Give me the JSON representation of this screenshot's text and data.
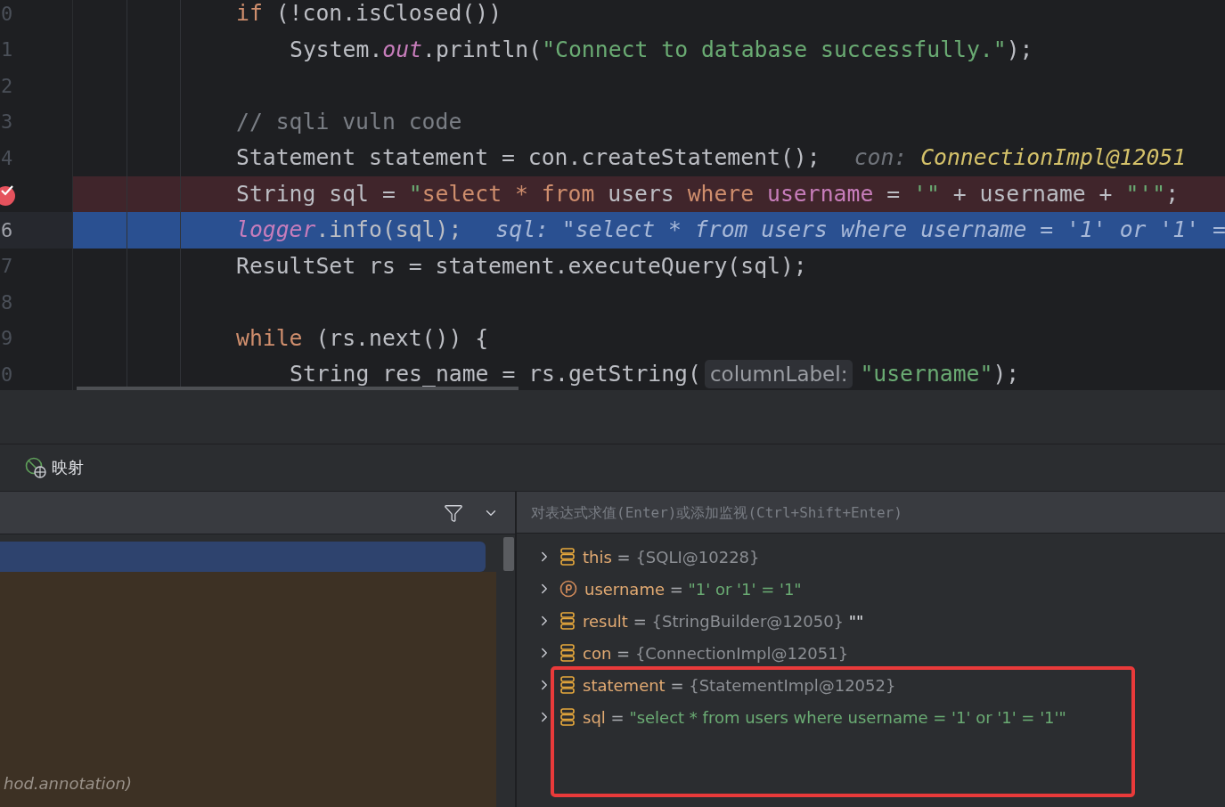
{
  "editor": {
    "lines": [
      {
        "number": "0",
        "kind": "outer",
        "current": false,
        "breakpoint": false,
        "segments": [
          {
            "kind": "code",
            "tokens": [
              {
                "text": "if",
                "kind": "keyword"
              },
              {
                "text": " (!con.isClosed())",
                "kind": "plain"
              }
            ]
          }
        ]
      },
      {
        "number": "1",
        "kind": "inner",
        "current": false,
        "breakpoint": false,
        "segments": [
          {
            "kind": "code",
            "tokens": [
              {
                "text": "System.",
                "kind": "plain"
              },
              {
                "text": "out",
                "kind": "static"
              },
              {
                "text": ".println(",
                "kind": "plain"
              },
              {
                "text": "\"Connect to database successfully.\"",
                "kind": "string"
              },
              {
                "text": ");",
                "kind": "plain"
              }
            ]
          }
        ]
      },
      {
        "number": "2",
        "kind": "outer",
        "current": false,
        "breakpoint": false
      },
      {
        "number": "3",
        "kind": "outer",
        "current": false,
        "breakpoint": false,
        "segments": [
          {
            "kind": "code",
            "tokens": [
              {
                "text": "// sqli vuln code",
                "kind": "comment"
              }
            ]
          }
        ]
      },
      {
        "number": "4",
        "kind": "outer",
        "current": false,
        "breakpoint": false,
        "segments": [
          {
            "kind": "code",
            "tokens": [
              {
                "text": "Statement statement = con.createStatement();",
                "kind": "plain"
              }
            ]
          },
          {
            "kind": "hint",
            "label": "con: ",
            "text": "ConnectionImpl@12051"
          }
        ]
      },
      {
        "kind": "outer",
        "current": false,
        "breakpoint": true,
        "segments": [
          {
            "kind": "code",
            "tokens": [
              {
                "text": "String sql = ",
                "kind": "plain"
              },
              {
                "text": "\"",
                "kind": "string"
              },
              {
                "text": "select * from",
                "kind": "sql_keyword"
              },
              {
                "text": " users ",
                "kind": "plain"
              },
              {
                "text": "where",
                "kind": "sql_keyword"
              },
              {
                "text": " username",
                "kind": "sql_column"
              },
              {
                "text": " = ",
                "kind": "plain"
              },
              {
                "text": "'\"",
                "kind": "string"
              },
              {
                "text": " + username + ",
                "kind": "plain"
              },
              {
                "text": "\"'\"",
                "kind": "string"
              },
              {
                "text": ";",
                "kind": "plain"
              }
            ]
          }
        ]
      },
      {
        "number": "6",
        "kind": "outer",
        "current": true,
        "breakpoint": false,
        "segments": [
          {
            "kind": "code",
            "tokens": [
              {
                "text": "logger",
                "kind": "static"
              },
              {
                "text": ".info(sql);",
                "kind": "plain"
              }
            ]
          },
          {
            "kind": "hint",
            "text": "sql: \"select * from users where username = '1' or '1' ="
          }
        ]
      },
      {
        "number": "7",
        "kind": "outer",
        "current": false,
        "breakpoint": false,
        "segments": [
          {
            "kind": "code",
            "tokens": [
              {
                "text": "ResultSet rs = statement.executeQuery(sql);",
                "kind": "plain"
              }
            ]
          }
        ]
      },
      {
        "number": "8",
        "kind": "outer",
        "current": false,
        "breakpoint": false
      },
      {
        "number": "9",
        "kind": "outer",
        "current": false,
        "breakpoint": false,
        "segments": [
          {
            "kind": "code",
            "tokens": [
              {
                "text": "while",
                "kind": "keyword"
              },
              {
                "text": " (rs.next()) {",
                "kind": "plain"
              }
            ]
          }
        ]
      },
      {
        "number": "0",
        "kind": "inner",
        "current": false,
        "breakpoint": false,
        "segments": [
          {
            "kind": "code",
            "tokens": [
              {
                "text": "String res_name = rs.getString(",
                "kind": "plain"
              }
            ]
          },
          {
            "kind": "inlay",
            "text": "columnLabel:"
          },
          {
            "kind": "code",
            "tokens": [
              {
                "text": "\"username\"",
                "kind": "string"
              },
              {
                "text": ");",
                "kind": "plain"
              }
            ]
          }
        ]
      }
    ]
  },
  "debug": {
    "tab": {
      "label": "映射"
    },
    "frames": [
      {
        "kind": "frame",
        "selected": true
      },
      {
        "kind": "library",
        "selected": false,
        "text": "hod.annotation)"
      }
    ],
    "expression_field": {
      "placeholder": "对表达式求值(Enter)或添加监视(Ctrl+Shift+Enter)"
    },
    "variables": [
      {
        "kind": "object",
        "name": "this",
        "operator": "=",
        "ref": "{SQLI@10228}"
      },
      {
        "kind": "parameter",
        "name": "username",
        "operator": "=",
        "string": "\"1' or '1' = '1\""
      },
      {
        "kind": "object",
        "name": "result",
        "operator": "=",
        "ref": "{StringBuilder@12050}",
        "suffix": "\"\""
      },
      {
        "kind": "object",
        "name": "con",
        "operator": "=",
        "ref": "{ConnectionImpl@12051}"
      },
      {
        "kind": "object",
        "name": "statement",
        "operator": "=",
        "ref": "{StatementImpl@12052}"
      },
      {
        "kind": "object",
        "name": "sql",
        "operator": "=",
        "string": "\"select * from users where username = '1' or '1' = '1'\""
      }
    ]
  }
}
